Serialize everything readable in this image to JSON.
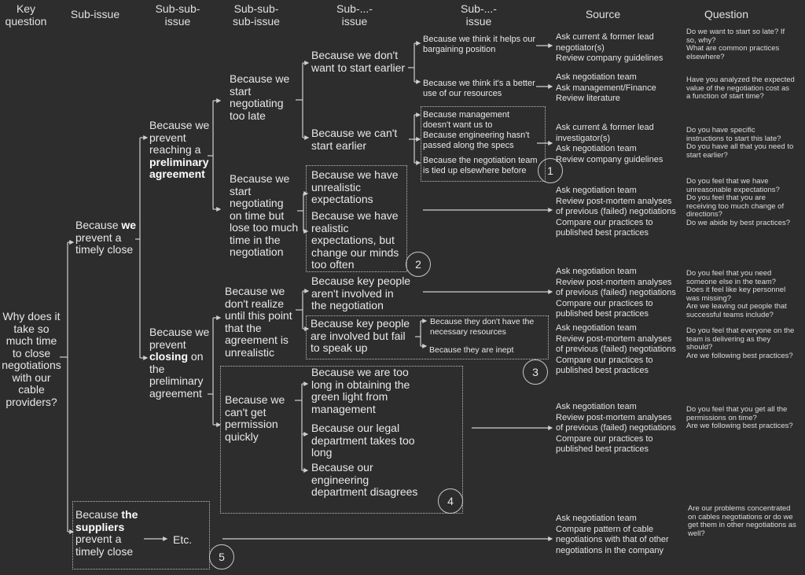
{
  "headers": {
    "key_question": "Key\nquestion",
    "sub_issue": "Sub-issue",
    "sub_sub_issue": "Sub-sub-\nissue",
    "sub_sub_sub_issue": "Sub-sub-\nsub-issue",
    "sub_n_issue_1": "Sub-...-\nissue",
    "sub_n_issue_2": "Sub-...-\nissue",
    "source": "Source",
    "question": "Question"
  },
  "key_question": "Why does it\ntake so\nmuch time\nto close\nnegotiations\nwith our\ncable\nproviders?",
  "sub_issues": {
    "we": {
      "pre": "Because ",
      "bold": "we",
      "post": "\nprevent a\ntimely close"
    },
    "suppliers": {
      "pre": "Because ",
      "bold": "the\nsuppliers",
      "post": "\nprevent a\ntimely close"
    },
    "etc": "Etc."
  },
  "sub_sub_issues": {
    "preliminary": {
      "pre": "Because we\nprevent\nreaching a\n",
      "bold": "preliminary\nagreement",
      "post": ""
    },
    "closing": {
      "pre": "Because we\nprevent\n",
      "bold": "closing",
      "post": " on\nthe\npreliminary\nagreement"
    }
  },
  "level3": {
    "too_late": "Because we\nstart\nnegotiating\ntoo late",
    "lose_time": "Because we\nstart\nnegotiating\non time but\nlose too much\ntime in the\nnegotiation",
    "dont_realize": "Because we\ndon't realize\nuntil this point\nthat the\nagreement is\nunrealistic",
    "permission": "Because we\ncan't get\npermission\nquickly"
  },
  "level4": {
    "dont_want": "Because we don't\nwant to start earlier",
    "cant_start": "Because we can't\nstart earlier",
    "unrealistic": "Because we have\nunrealistic\nexpectations",
    "change_minds": "Because we have\nrealistic\nexpectations, but\nchange our minds\ntoo often",
    "key_not_involved": "Because key people\naren't involved in\nthe negotiation",
    "key_fail_speak": "Because key people\nare involved but fail\nto speak up",
    "green_light": "Because we are too\nlong in obtaining the\ngreen light from\nmanagement",
    "legal": "Because our legal\ndepartment takes too\nlong",
    "engineering": "Because our\nengineering\ndepartment disagrees"
  },
  "level5": {
    "bargaining": "Because we think it helps our\nbargaining position",
    "resources": "Because we think it's a better\nuse of our resources",
    "management": "Because management\ndoesn't want us to",
    "specs": "Because engineering hasn't\npassed along the specs",
    "tied_up": "Because the negotiation team\nis tied up elsewhere before",
    "no_resources": "Because they don't have the\nnecessary resources",
    "inept": "Because they are inept"
  },
  "sources": [
    "Ask current & former lead\nnegotiator(s)\nReview company guidelines",
    "Ask negotiation team\nAsk management/Finance\nReview literature",
    "Ask current & former lead\ninvestigator(s)\nAsk negotiation team\nReview company guidelines",
    "Ask negotiation team\nReview post-mortem analyses\nof previous (failed) negotiations\nCompare our practices to\npublished best practices",
    "Ask negotiation team\nReview post-mortem analyses\nof previous (failed) negotiations\nCompare our practices to\npublished best practices",
    "Ask negotiation team\nReview post-mortem analyses\nof previous (failed) negotiations\nCompare our practices to\npublished best practices",
    "Ask negotiation team\nReview post-mortem analyses\nof previous (failed) negotiations\nCompare our practices to\npublished best practices",
    "Ask negotiation team\nCompare pattern of cable\nnegotiations with that of other\nnegotiations in the company"
  ],
  "questions": [
    "Do we want to start so late? If\nso, why?\nWhat are common practices\nelsewhere?",
    "Have you analyzed the expected\nvalue of the negotiation cost as\na function of start time?",
    "Do you have specific\ninstructions to start this late?\nDo you have all that you need to\nstart earlier?",
    "Do you feel that we have\nunreasonable expectations?\nDo you feel that you are\nreceiving too much change of\ndirections?\nDo we abide by best practices?",
    "Do you feel that you need\nsomeone else in the team?\nDoes it feel like key personnel\nwas missing?\nAre we leaving out people that\nsuccessful teams include?",
    "Do you feel that everyone on the\nteam is delivering as they\nshould?\nAre we following best practices?",
    "Do you feel that you get all the\npermissions on time?\nAre we following best practices?",
    "Are our problems concentrated\non cables negotiations or do we\nget them in other negotiations as\nwell?"
  ],
  "group_numbers": [
    "1",
    "2",
    "3",
    "4",
    "5"
  ]
}
